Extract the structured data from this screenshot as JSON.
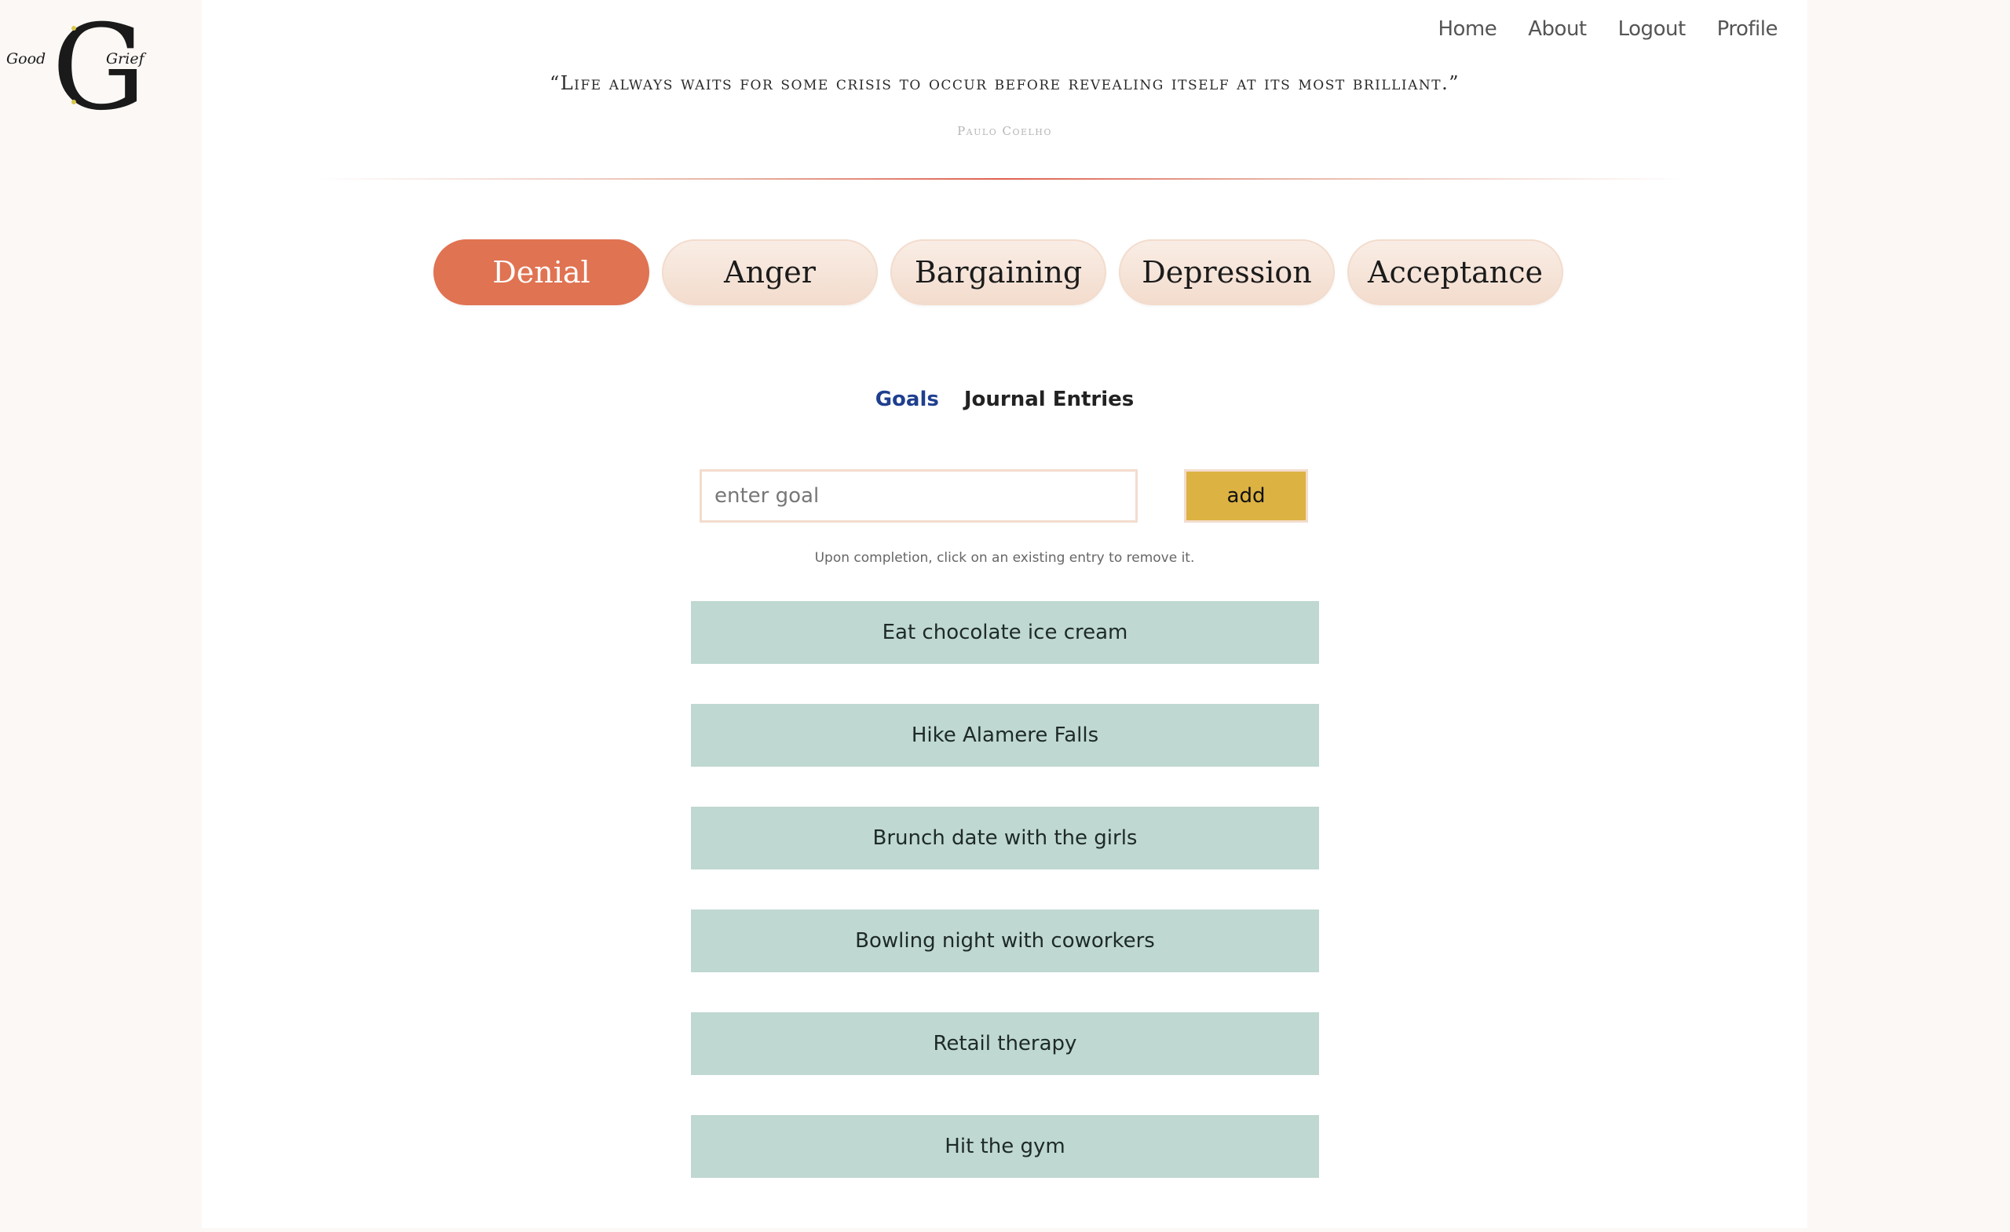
{
  "logo": {
    "left_word": "Good",
    "right_word": "Grief",
    "monogram": "GG"
  },
  "nav": {
    "items": [
      {
        "label": "Home"
      },
      {
        "label": "About"
      },
      {
        "label": "Logout"
      },
      {
        "label": "Profile"
      }
    ]
  },
  "quote": {
    "text": "“Life always waits for some crisis to occur before revealing itself at its most brilliant.”",
    "author": "Paulo Coelho"
  },
  "stages": [
    {
      "label": "Denial",
      "active": true
    },
    {
      "label": "Anger",
      "active": false
    },
    {
      "label": "Bargaining",
      "active": false
    },
    {
      "label": "Depression",
      "active": false
    },
    {
      "label": "Acceptance",
      "active": false
    }
  ],
  "tabs": [
    {
      "label": "Goals",
      "active": true
    },
    {
      "label": "Journal Entries",
      "active": false
    }
  ],
  "goal_form": {
    "placeholder": "enter goal",
    "value": "",
    "add_label": "add",
    "hint": "Upon completion, click on an existing entry to remove it."
  },
  "goals": [
    {
      "text": "Eat chocolate ice cream"
    },
    {
      "text": "Hike Alamere Falls"
    },
    {
      "text": "Brunch date with the girls"
    },
    {
      "text": "Bowling night with coworkers"
    },
    {
      "text": "Retail therapy"
    },
    {
      "text": "Hit the gym"
    }
  ],
  "colors": {
    "accent": "#e07352",
    "stage_bg": "#f3dccd",
    "add_button": "#dcb243",
    "goal_bg": "#bfd8d1",
    "active_tab": "#1f3f8f"
  }
}
